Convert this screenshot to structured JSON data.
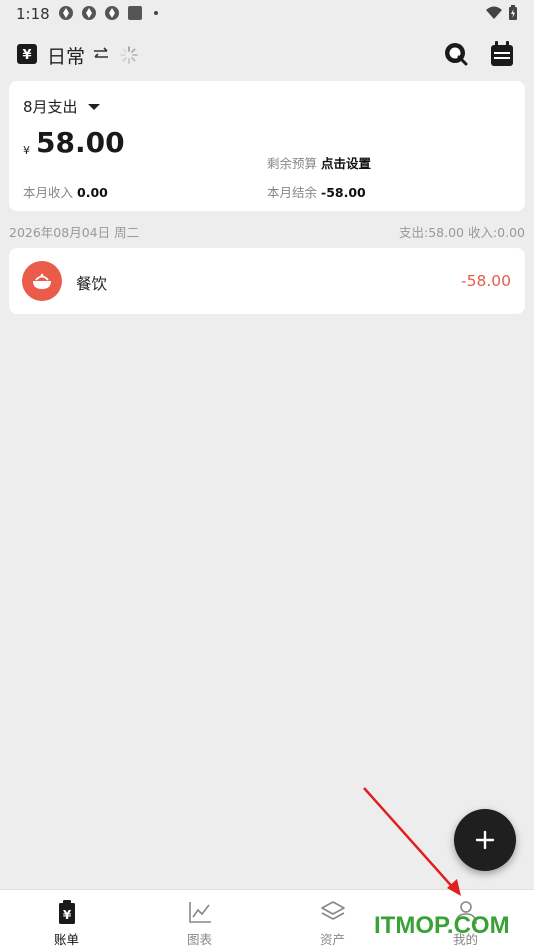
{
  "status": {
    "time": "1:18",
    "left_icons": [
      "app-notify-icon",
      "app-notify-icon",
      "app-notify-icon",
      "square-app-icon"
    ],
    "right_icons": [
      "wifi-icon",
      "battery-charging-icon"
    ]
  },
  "header": {
    "book_title": "日常",
    "icons": [
      "ledger-book-icon",
      "switch-arrows-icon",
      "loading-spinner-icon",
      "search-icon",
      "calendar-icon"
    ]
  },
  "summary": {
    "month_label": "8月支出",
    "currency": "¥",
    "expense_amount": "58.00",
    "budget_label": "剩余预算",
    "budget_value": "点击设置",
    "income_label": "本月收入",
    "income_value": "0.00",
    "balance_label": "本月结余",
    "balance_value": "-58.00"
  },
  "day_group": {
    "date": "2026年08月04日 周二",
    "totals": "支出:58.00  收入:0.00"
  },
  "records": [
    {
      "category": "餐饮",
      "amount": "-58.00",
      "icon": "bowl-icon",
      "icon_color": "#ea5b4a"
    }
  ],
  "fab": {
    "icon": "plus-icon"
  },
  "bottom_nav": [
    {
      "label": "账单",
      "icon": "bill-icon",
      "active": true
    },
    {
      "label": "图表",
      "icon": "chart-line-icon",
      "active": false
    },
    {
      "label": "资产",
      "icon": "layers-icon",
      "active": false
    },
    {
      "label": "我的",
      "icon": "person-icon",
      "active": false
    }
  ],
  "watermark": "ITMOP.COM",
  "colors": {
    "background": "#ededed",
    "expense_red": "#e85c4c",
    "fab": "#1f1f1f",
    "annotation_arrow": "#e02020",
    "watermark": "#3aa135"
  }
}
